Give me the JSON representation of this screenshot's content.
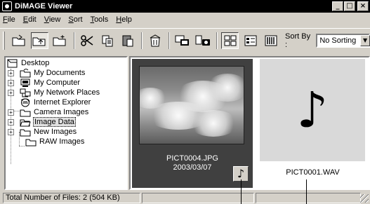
{
  "window": {
    "title": "DiMAGE Viewer",
    "controls": [
      "_",
      "□",
      "×"
    ]
  },
  "menu": {
    "items": [
      "File",
      "Edit",
      "View",
      "Sort",
      "Tools",
      "Help"
    ]
  },
  "toolbar": {
    "buttons": [
      {
        "icon": "open-folder-icon"
      },
      {
        "icon": "folder-up-icon",
        "pressed": true
      },
      {
        "icon": "new-folder-icon"
      },
      {
        "icon": "cut-icon"
      },
      {
        "icon": "copy-icon"
      },
      {
        "icon": "paste-icon"
      },
      {
        "icon": "recycle-bin-icon"
      },
      {
        "icon": "image-processing-icon"
      },
      {
        "icon": "camera-settings-icon"
      },
      {
        "icon": "large-thumbnails-icon",
        "pressed": true
      },
      {
        "icon": "small-thumbnails-icon"
      },
      {
        "icon": "details-view-icon"
      }
    ],
    "sort_label": "Sort By :",
    "sort_value": "No Sorting"
  },
  "tree": {
    "items": [
      {
        "label": "Desktop",
        "icon": "desktop-icon",
        "expander": "-"
      },
      {
        "label": "My Documents",
        "icon": "folder-icon",
        "expander": "+"
      },
      {
        "label": "My Computer",
        "icon": "computer-icon",
        "expander": "+"
      },
      {
        "label": "My Network Places",
        "icon": "network-icon",
        "expander": "+"
      },
      {
        "label": "Internet Explorer",
        "icon": "internet-explorer-icon",
        "expander": ""
      },
      {
        "label": "Camera Images",
        "icon": "folder-icon",
        "expander": "+"
      },
      {
        "label": "Image Data",
        "icon": "open-folder-icon",
        "expander": "+",
        "selected": true
      },
      {
        "label": "New Images",
        "icon": "folder-icon",
        "expander": "+"
      },
      {
        "label": "RAW Images",
        "icon": "folder-icon",
        "expander": ""
      }
    ]
  },
  "thumbnails": [
    {
      "filename": "PICT0004.JPG",
      "date": "2003/03/07",
      "badge": "♪",
      "selected": true
    },
    {
      "filename": "PICT0001.WAV",
      "symbol": "♪"
    }
  ],
  "status": {
    "text": "Total Number of Files: 2 (504 KB)"
  }
}
